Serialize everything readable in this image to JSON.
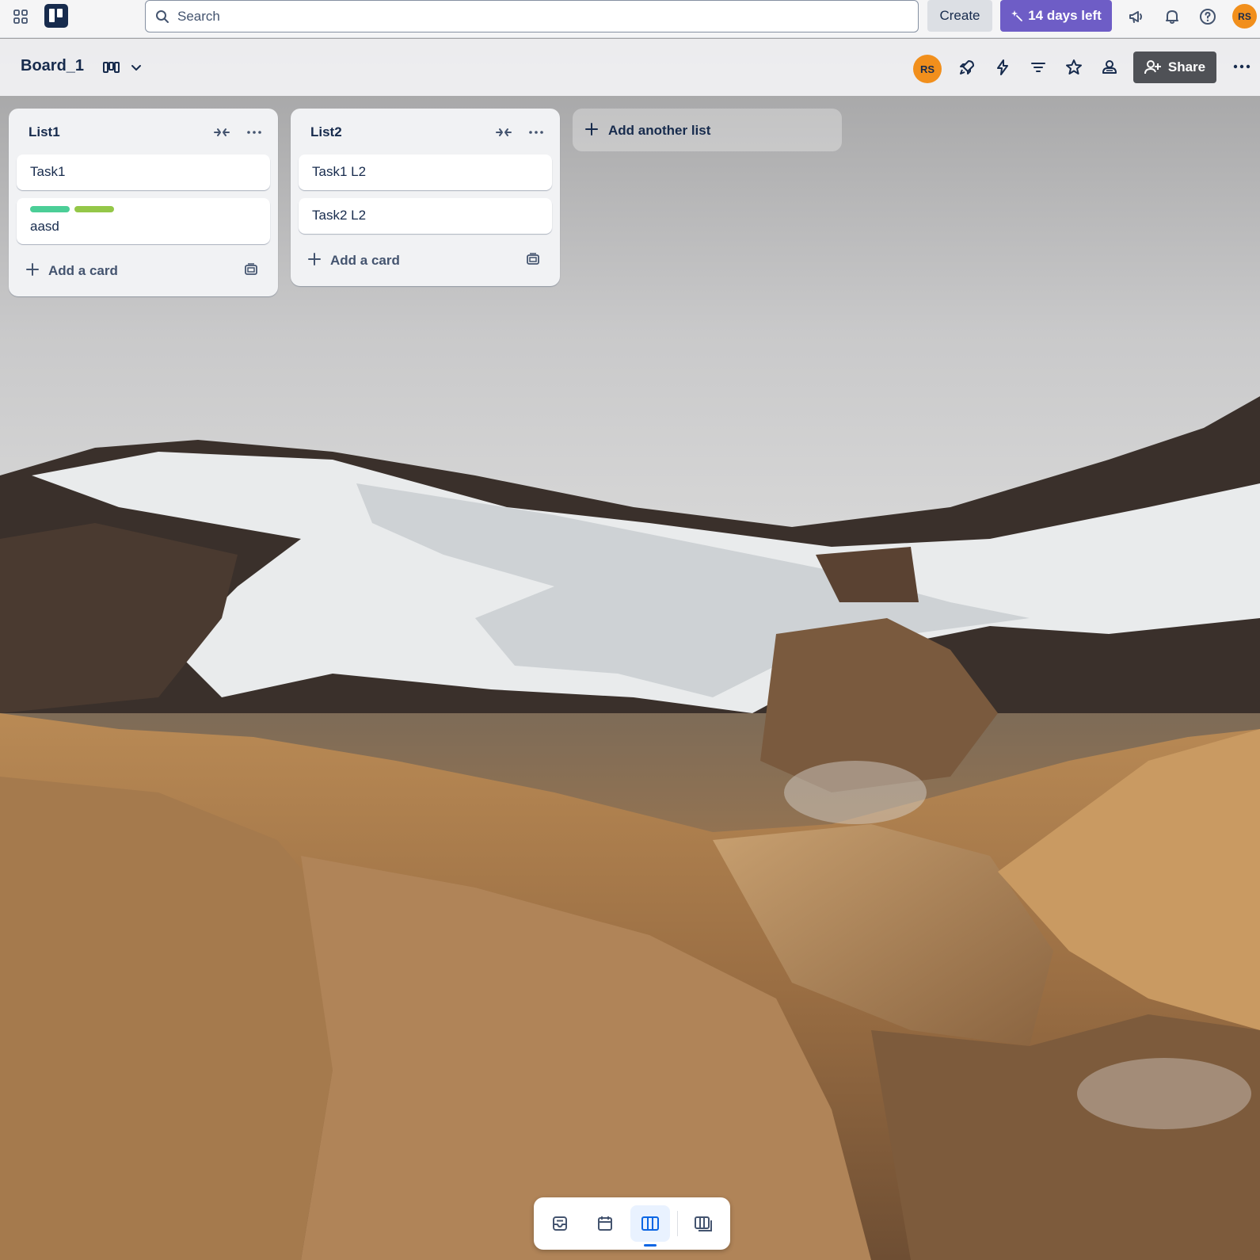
{
  "topbar": {
    "search_placeholder": "Search",
    "create_label": "Create",
    "trial_label": "14 days left",
    "user_initials": "RS"
  },
  "board": {
    "title": "Board_1",
    "member_initials": "RS",
    "share_label": "Share"
  },
  "lists": [
    {
      "title": "List1",
      "cards": [
        {
          "title": "Task1",
          "labels": []
        },
        {
          "title": "aasd",
          "labels": [
            "#4bce97",
            "#94c748"
          ]
        }
      ],
      "add_card_label": "Add a card"
    },
    {
      "title": "List2",
      "cards": [
        {
          "title": "Task1 L2",
          "labels": []
        },
        {
          "title": "Task2 L2",
          "labels": []
        }
      ],
      "add_card_label": "Add a card"
    }
  ],
  "add_list_label": "Add another list",
  "colors": {
    "trial_purple": "#6e5dc6",
    "avatar_orange": "#f18f1c",
    "label_green": "#4bce97",
    "label_lime": "#94c748",
    "active_blue": "#0c66e4"
  },
  "bottom_views": [
    "inbox-icon",
    "calendar-icon",
    "board-icon",
    "switch-boards-icon"
  ],
  "bottom_active_view": "board-icon"
}
